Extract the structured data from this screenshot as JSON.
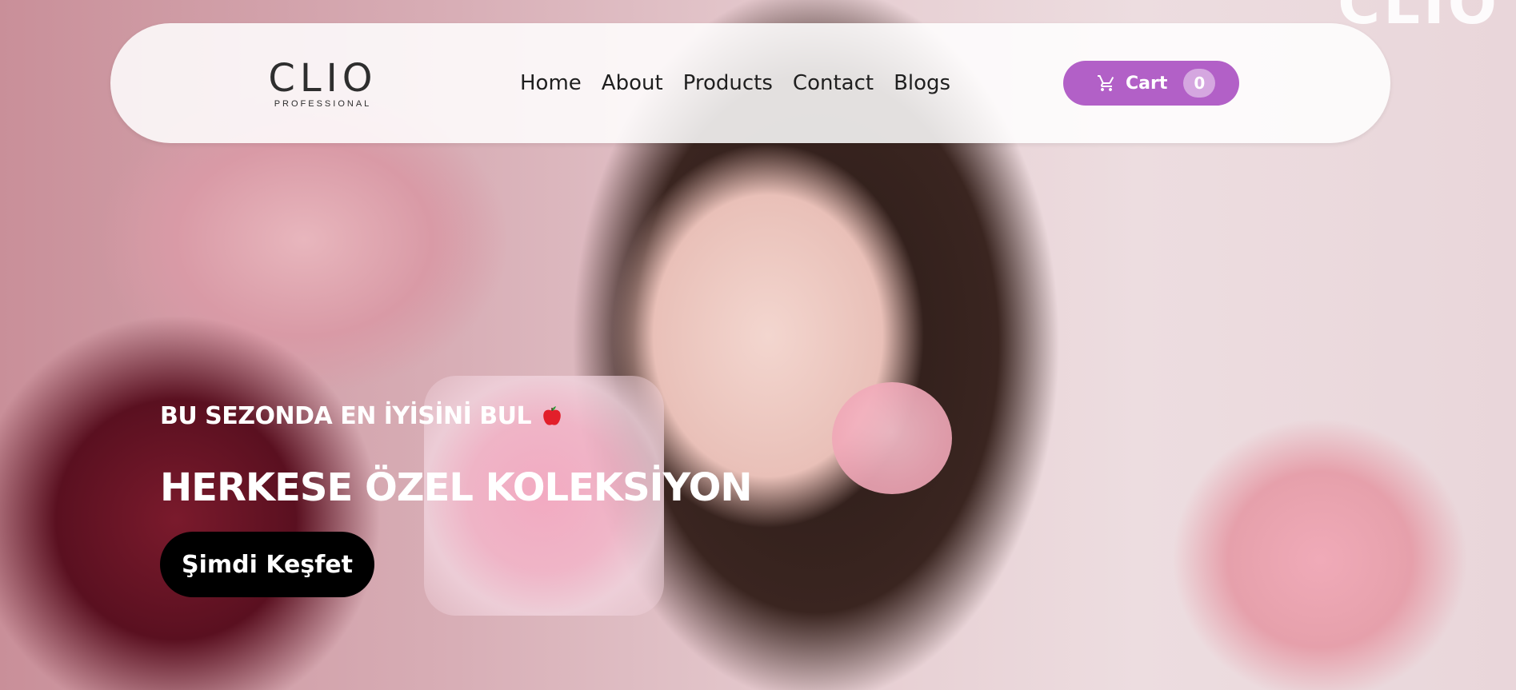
{
  "brand": {
    "logo_main": "CLIO",
    "logo_sub": "PROFESSIONAL",
    "watermark": "CLIO"
  },
  "nav": {
    "items": [
      {
        "label": "Home"
      },
      {
        "label": "About"
      },
      {
        "label": "Products"
      },
      {
        "label": "Contact"
      },
      {
        "label": "Blogs"
      }
    ]
  },
  "cart": {
    "icon": "cart-icon",
    "label": "Cart",
    "count": "0",
    "color": "#b260c7"
  },
  "hero": {
    "tagline": "BU SEZONDA EN İYİSİNİ BUL",
    "tagline_icon": "apple-icon",
    "headline": "HERKESE ÖZEL KOLEKSİYON",
    "cta_label": "Şimdi Keşfet"
  }
}
